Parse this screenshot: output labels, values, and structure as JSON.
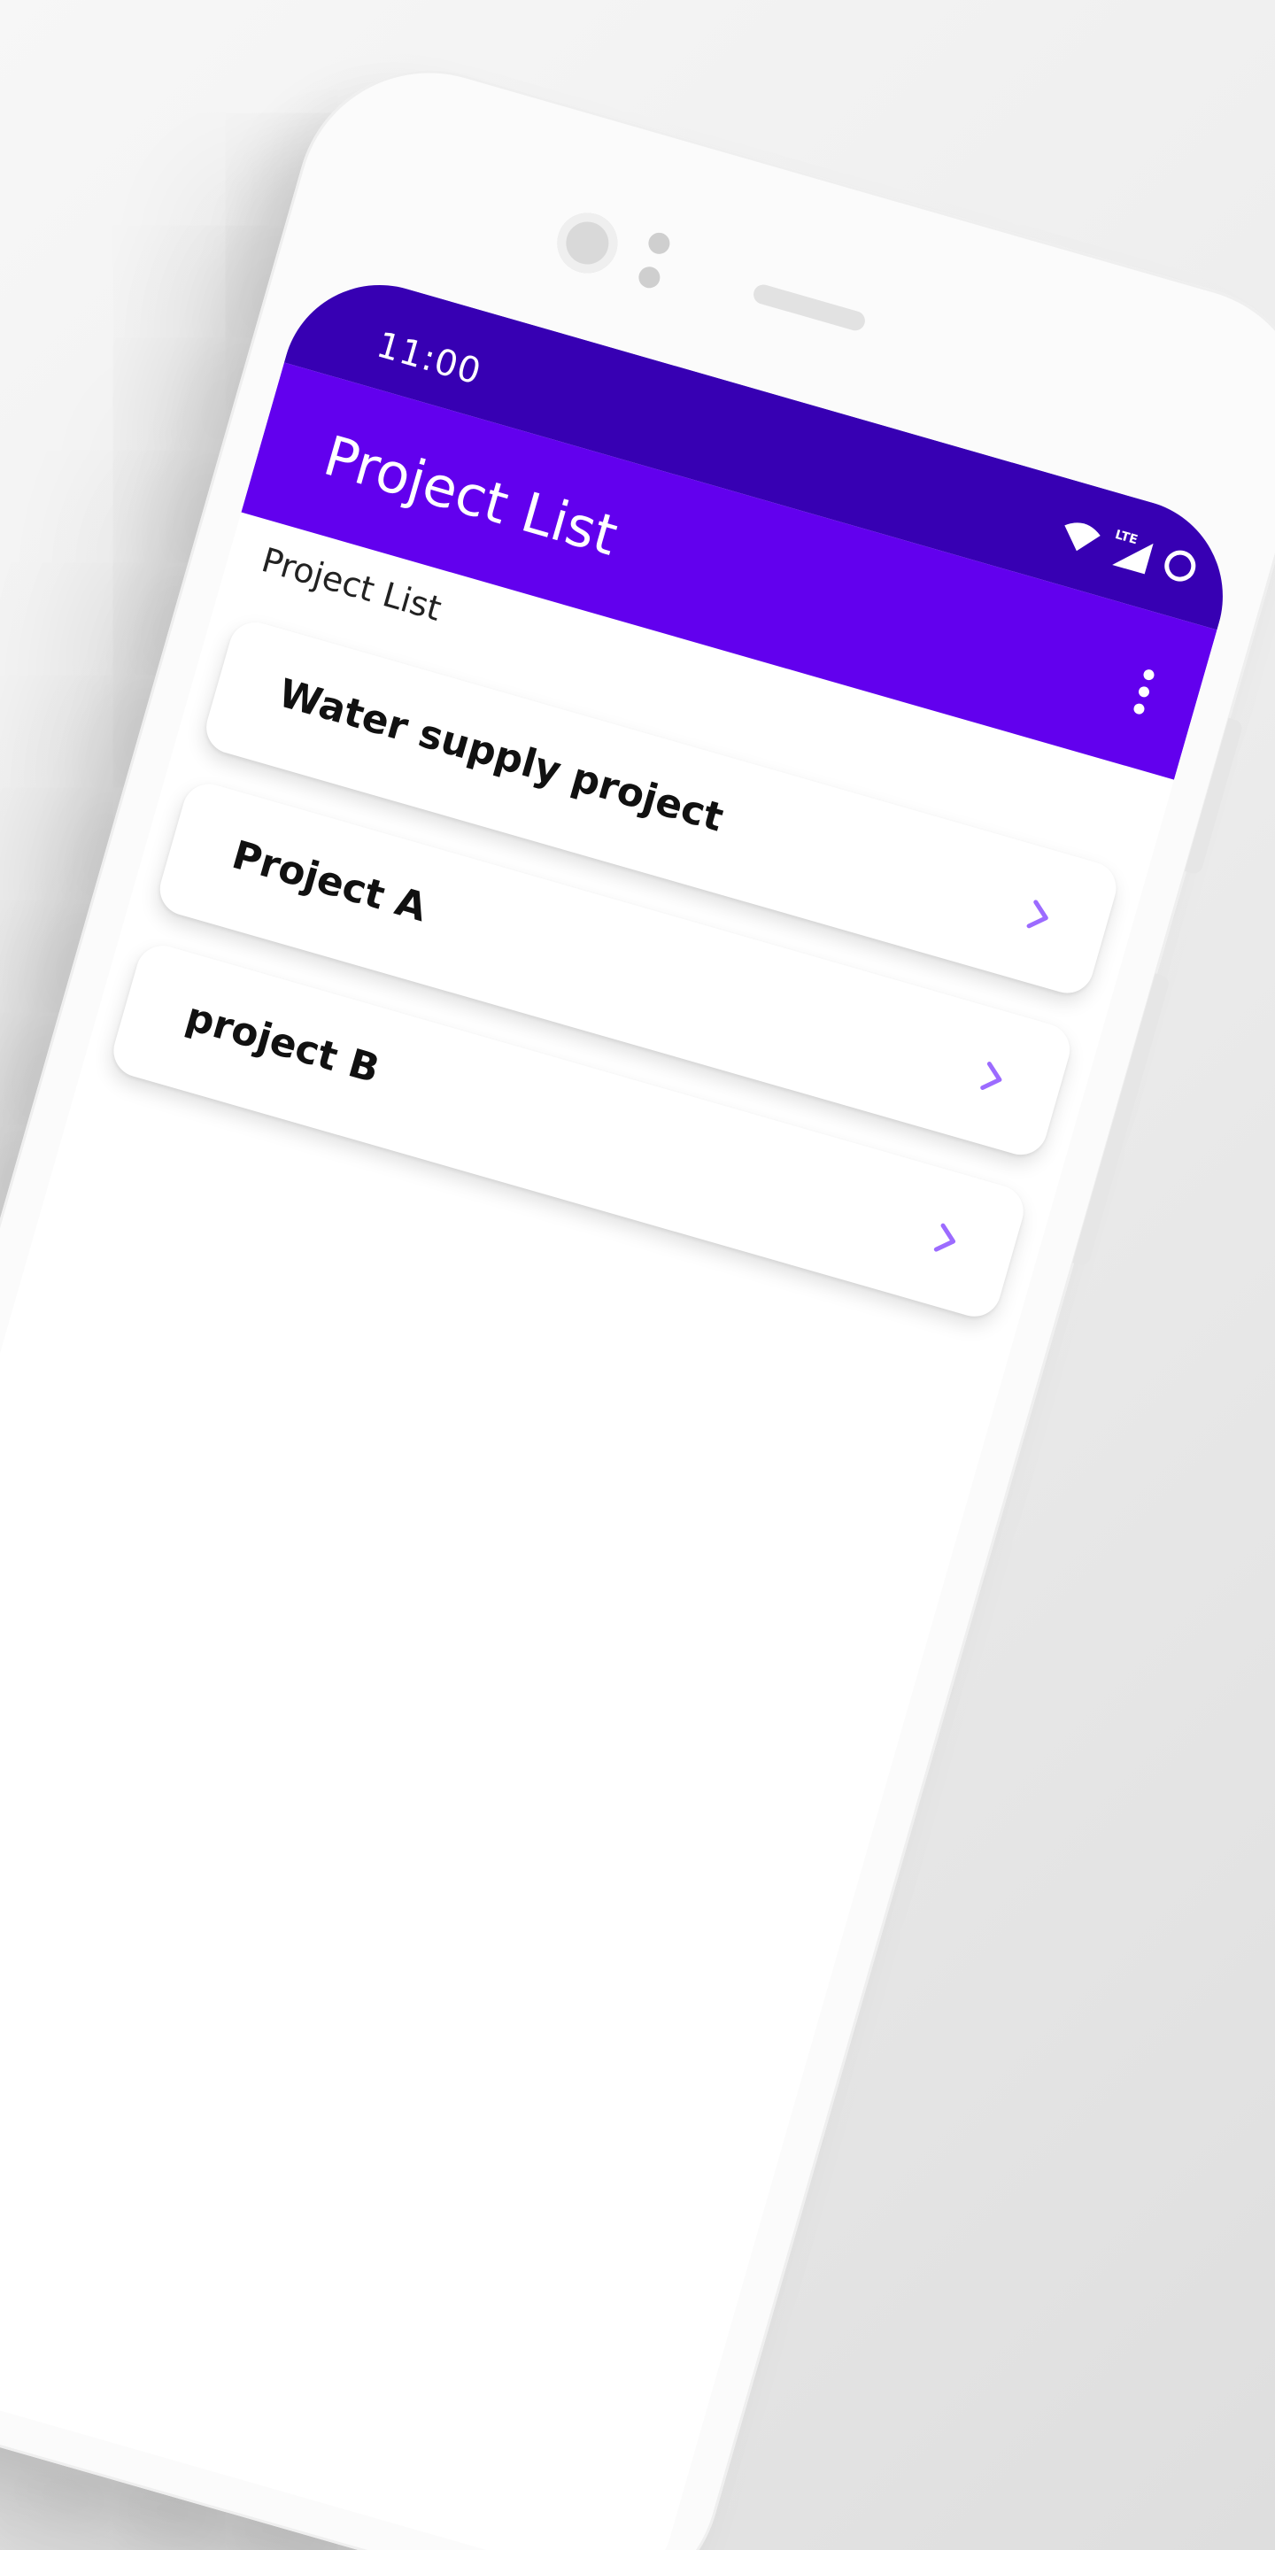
{
  "status_bar": {
    "time": "11:00",
    "network_label": "LTE",
    "icons": [
      "wifi-icon",
      "lte-signal-icon",
      "battery-icon"
    ]
  },
  "app_bar": {
    "title": "Project List",
    "menu_icon": "more-vert-icon"
  },
  "page": {
    "label": "Project List"
  },
  "projects": [
    {
      "name": "Water supply project",
      "icon": "chevron-right-icon"
    },
    {
      "name": "Project A",
      "icon": "chevron-right-icon"
    },
    {
      "name": "project B",
      "icon": "chevron-right-icon"
    }
  ],
  "colors": {
    "status_bar": "#3700b3",
    "app_bar": "#6200ee",
    "accent": "#9c6bff",
    "background": "#ffffff"
  }
}
